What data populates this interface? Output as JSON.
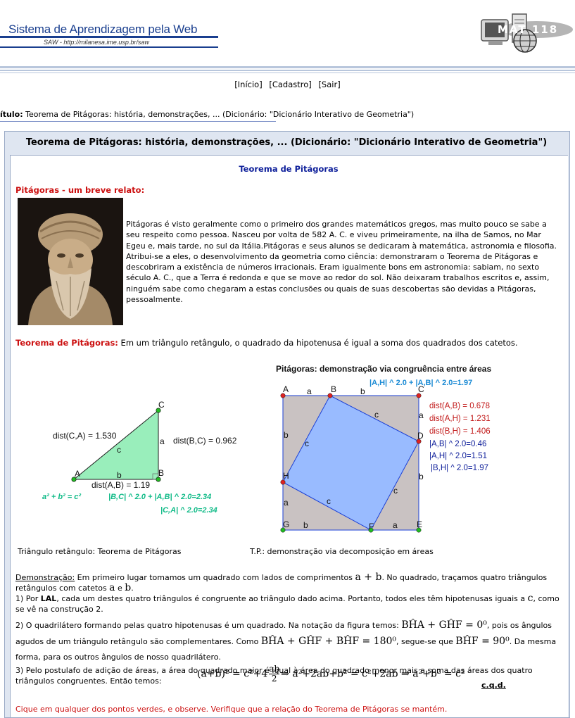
{
  "header": {
    "title": "Sistema de Aprendizagem pela Web",
    "subtitle": "SAW - http://milanesa.ime.usp.br/saw",
    "logo_text": "MAT 118"
  },
  "nav": {
    "inicio": "[Início]",
    "cadastro": "[Cadastro]",
    "sair": "[Sair]"
  },
  "title_row": {
    "label": "ítulo:",
    "text": "Teorema de Pitágoras: história, demonstrações, ...   (Dicionário: \"Dicionário Interativo de Geometria\")"
  },
  "panel": {
    "heading": "Teorema de Pitágoras: história, demonstrações, ...   (Dicionário: \"Dicionário Interativo de Geometria\")",
    "article_title": "Teorema de Pitágoras",
    "section1_heading": "Pitágoras - um breve relato:",
    "section1_text": "Pitágoras é visto geralmente como o primeiro dos grandes matemáticos gregos, mas muito pouco se sabe a seu respeito como pessoa. Nasceu por volta de 582 A. C. e viveu primeiramente, na ilha de Samos, no Mar Egeu e, mais tarde, no sul da Itália.Pitágoras e seus alunos se dedicaram à matemática, astronomia e filosofia. Atribui-se a eles, o desenvolvimento da geometria como ciência: demonstraram o Teorema de Pitágoras e descobriram a existência de números irracionais. Eram igualmente bons em astronomia: sabiam, no sexto século A. C., que a Terra é redonda e que se move ao redor do sol. Não deixaram trabalhos escritos e, assim, ninguém sabe como chegaram a estas conclusões ou quais de suas descobertas são devidas a Pitágoras, pessoalmente.",
    "theorem_label": "Teorema de Pitágoras:",
    "theorem_text": " Em um triângulo retângulo, o quadrado da hipotenusa é igual a soma dos quadrados dos catetos.",
    "caption1": "Triângulo retângulo: Teorema de Pitágoras",
    "caption2": "T.P.: demonstração via decomposição em áreas"
  },
  "triangle": {
    "dist_ca": "dist(C,A) = 1.530",
    "dist_bc": "dist(B,C) = 0.962",
    "dist_ab": "dist(A,B) = 1.19",
    "formula": "a² + b² = c²",
    "bc_ab": "|B,C| ^ 2.0 + |A,B| ^ 2.0=2.34",
    "ca": "|C,A| ^ 2.0=2.34",
    "pA": "A",
    "pB": "B",
    "pC": "C",
    "sa": "a",
    "sb": "b",
    "sc": "c"
  },
  "square": {
    "title": "Pitágoras: demonstração via congruência entre áreas",
    "top_formula": "|A,H| ^ 2.0 +  |A,B| ^ 2.0=1.97",
    "dist_ab": "dist(A,B) = 0.678",
    "dist_ah": "dist(A,H) = 1.231",
    "dist_bh": "dist(B,H) = 1.406",
    "ab2": "|A,B| ^ 2.0=0.46",
    "ah2": "|A,H| ^ 2.0=1.51",
    "bh2": "|B,H| ^ 2.0=1.97",
    "pA": "A",
    "pB": "B",
    "pC": "C",
    "pD": "D",
    "pE": "E",
    "pF": "F",
    "pG": "G",
    "pH": "H",
    "a": "a",
    "b": "b",
    "c": "c"
  },
  "demo": {
    "label": "Demonstração:",
    "line1a": " Em primeiro lugar tomamos um quadrado com lados de comprimentos ",
    "ab": "a + b",
    "line1b": ". No quadrado, traçamos quatro triângulos retângulos com catetos ",
    "a": "a",
    "e": " e ",
    "b": "b",
    "dot": ".",
    "step1a": "1) Por ",
    "lal": "LAL",
    "step1b": ", cada um destes quatro triângulos é congruente ao triângulo dado acima. Portanto, todos eles têm hipotenusas iguais a ",
    "c": "c",
    "step1c": ", como se vê na construção 2.",
    "step2a": "2) O quadrilátero formando pelas quatro hipotenusas é um quadrado. Na notação da figura temos: ",
    "eq1": "BĤA + GĤF = 0⁰",
    "step2b": ", pois os ângulos agudos de um triângulo retângulo são complementares. Como ",
    "eq2": "BĤA + GĤF + BĤF = 180⁰",
    "step2c": ", segue-se que ",
    "eq3": "BĤF = 90⁰",
    "step2d": ". Da mesma forma, para os outros ângulos de nosso quadrilátero.",
    "step3": "3) Pelo postulafo de adição de áreas, a área do quadrado maior é igual à área do quadrado menor mais a soma das áreas dos quatro triângulos congruentes. Então temos:",
    "eq4a": "(a+b)² = c²+4",
    "eq4num": "ab",
    "eq4den": "2",
    "eq4b": "⇒ a²+2ab+b² = c²+2ab ⇒ a²+b² = c²",
    "cqd": "c.q.d.",
    "click_note": "Cique em qualquer dos pontos verdes, e observe. Verifique que a relação do Teorema de Pitágoras se mantém."
  }
}
